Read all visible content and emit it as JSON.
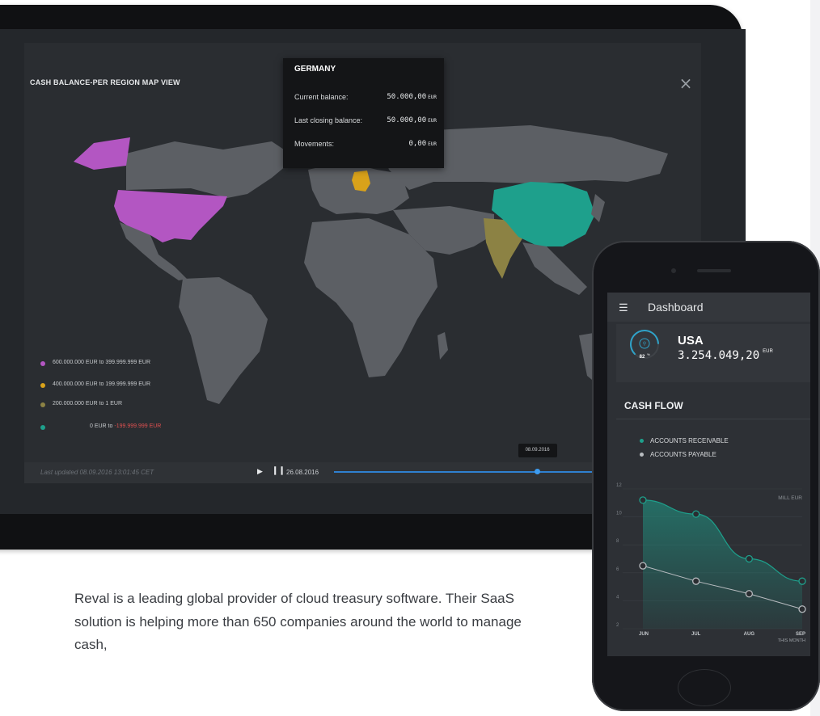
{
  "colors": {
    "purple": "#b356c2",
    "gold": "#d9a21a",
    "olive": "#8c8244",
    "teal": "#1ea08c",
    "land": "#5c5f64",
    "ocean": "#2a2d31",
    "accent": "#2f80d0"
  },
  "map": {
    "title": "CASH BALANCE-PER REGION MAP VIEW",
    "close_icon": "close-icon",
    "tooltip": {
      "country": "GERMANY",
      "rows": [
        {
          "label": "Current balance:",
          "value": "50.000,00",
          "unit": "EUR"
        },
        {
          "label": "Last closing balance:",
          "value": "50.000,00",
          "unit": "EUR"
        },
        {
          "label": "Movements:",
          "value": "0,00",
          "unit": "EUR"
        }
      ]
    },
    "legend": [
      {
        "text": "600.000.000 EUR  to  399.999.999 EUR",
        "color": "#b356c2"
      },
      {
        "text": "400.000.000 EUR  to  199.999.999 EUR",
        "color": "#d9a21a"
      },
      {
        "text": "200.000.000 EUR  to  1 EUR",
        "color": "#8c8244"
      },
      {
        "from": "0 EUR  to ",
        "to": "-199.999.999 EUR",
        "color": "#1ea08c"
      }
    ],
    "last_updated": "Last updated 08.09.2016  13:01:45 CET",
    "timeline": {
      "date": "26.08.2016",
      "tooltip": "08.09.2016",
      "progress": 0.74
    }
  },
  "phone": {
    "header_title": "Dashboard",
    "menu_icon": "hamburger-icon",
    "region": {
      "name": "USA",
      "value": "3.254.049,20",
      "unit": "EUR",
      "gauge_percent": 82,
      "gauge_label": "82",
      "gauge_unit": "%"
    },
    "cash_flow_title": "CASH FLOW",
    "legend": [
      {
        "label": "ACCOUNTS RECEIVABLE",
        "color": "#1ea08c"
      },
      {
        "label": "ACCOUNTS PAYABLE",
        "color": "#b8bcc0"
      }
    ],
    "chart_data": {
      "type": "area",
      "categories": [
        "JUN",
        "JUL",
        "AUG",
        "SEP"
      ],
      "category_sublabels": [
        "",
        "",
        "",
        "THIS MONTH"
      ],
      "series": [
        {
          "name": "ACCOUNTS RECEIVABLE",
          "values": [
            11.2,
            10.2,
            7.0,
            5.4
          ]
        },
        {
          "name": "ACCOUNTS PAYABLE",
          "values": [
            6.5,
            5.4,
            4.5,
            3.4
          ]
        }
      ],
      "unit_label": "MILL EUR",
      "yticks": [
        2,
        4,
        6,
        8,
        10,
        12
      ],
      "ylim": [
        2,
        12
      ]
    }
  },
  "intro_text": "Reval is a leading global provider of cloud treasury software. Their SaaS solution is helping more than 650 companies around the world to manage cash,"
}
